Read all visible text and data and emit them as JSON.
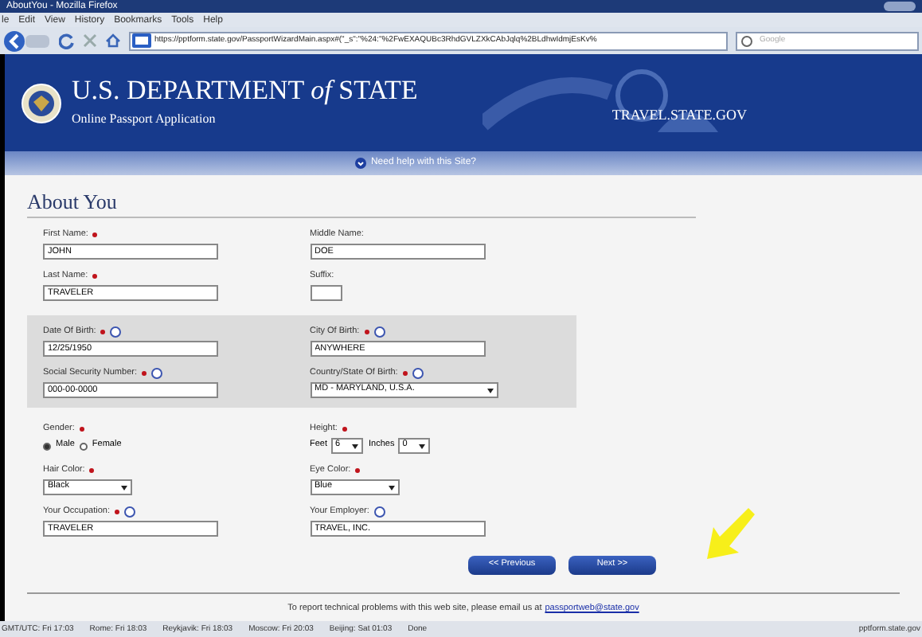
{
  "window": {
    "title": "AboutYou - Mozilla Firefox"
  },
  "menu": [
    "le",
    "Edit",
    "View",
    "History",
    "Bookmarks",
    "Tools",
    "Help"
  ],
  "address_bar": {
    "url": "https://pptform.state.gov/PassportWizardMain.aspx#(\"_s\":\"%24:\"%2FwEXAQUBc3RhdGVLZXkCAbJqlq%2BLdhwIdmjEsKv%"
  },
  "search": {
    "placeholder": "Google"
  },
  "banner": {
    "title": "U.S. DEPARTMENT",
    "title_em": "of",
    "title_end": "STATE",
    "subtitle": "Online Passport Application",
    "site": "TRAVEL.STATE.GOV"
  },
  "help_link": "Need help with this Site?",
  "heading": "About You",
  "sections": [
    {
      "shaded": false,
      "rows": [
        [
          {
            "label": "First Name:",
            "required": true,
            "help": false,
            "kind": "text",
            "value": "JOHN"
          },
          {
            "label": "Middle Name:",
            "required": false,
            "help": false,
            "kind": "text",
            "value": "DOE"
          }
        ],
        [
          {
            "label": "Last Name:",
            "required": true,
            "help": false,
            "kind": "text",
            "value": "TRAVELER"
          },
          {
            "label": "Suffix:",
            "required": false,
            "help": false,
            "kind": "short"
          }
        ]
      ]
    },
    {
      "shaded": true,
      "rows": [
        [
          {
            "label": "Date Of Birth:",
            "required": true,
            "help": true,
            "kind": "text",
            "value": "12/25/1950"
          },
          {
            "label": "City Of Birth:",
            "required": true,
            "help": true,
            "kind": "text",
            "value": "ANYWHERE"
          }
        ],
        [
          {
            "label": "Social Security Number:",
            "required": true,
            "help": true,
            "kind": "text",
            "value": "000-00-0000"
          },
          {
            "label": "Country/State Of Birth:",
            "required": true,
            "help": true,
            "kind": "select",
            "value": "MD - MARYLAND, U.S.A."
          }
        ]
      ]
    },
    {
      "shaded": false,
      "rows": [
        [
          {
            "label": "Gender:",
            "required": true,
            "help": false,
            "kind": "radio",
            "options": [
              {
                "label": "Male",
                "selected": true
              },
              {
                "label": "Female",
                "selected": false
              }
            ]
          },
          {
            "label": "Height:",
            "required": true,
            "help": false,
            "kind": "height",
            "feet_label": "Feet",
            "feet": "6",
            "inches_label": "Inches",
            "inches": "0"
          }
        ],
        [
          {
            "label": "Hair Color:",
            "required": true,
            "help": false,
            "kind": "select",
            "value": "Black"
          },
          {
            "label": "Eye Color:",
            "required": true,
            "help": false,
            "kind": "select",
            "value": "Blue"
          }
        ],
        [
          {
            "label": "Your Occupation:",
            "required": true,
            "help": true,
            "kind": "text",
            "value": "TRAVELER"
          },
          {
            "label": "Your Employer:",
            "required": false,
            "help": true,
            "kind": "text",
            "value": "TRAVEL, INC."
          }
        ]
      ]
    }
  ],
  "buttons": [
    "<< Previous",
    "Next >>"
  ],
  "footer": {
    "text": "To report technical problems with this web site, please email us at",
    "link": "passportweb@state.gov"
  },
  "status_bar": {
    "items": [
      "GMT/UTC: Fri 17:03",
      "Rome: Fri 18:03",
      "Reykjavik: Fri 18:03",
      "Moscow: Fri 20:03",
      "Beijing: Sat 01:03",
      "Done"
    ],
    "host": "pptform.state.gov"
  }
}
